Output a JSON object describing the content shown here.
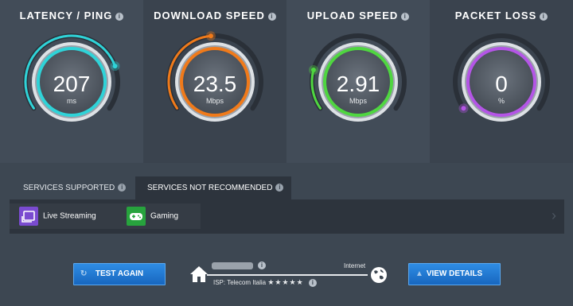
{
  "gauges": [
    {
      "title": "LATENCY / PING",
      "value": "207",
      "unit": "ms",
      "color": "#2fd3d8",
      "level": 0.78
    },
    {
      "title": "DOWNLOAD SPEED",
      "value": "23.5",
      "unit": "Mbps",
      "color": "#f07a1a",
      "level": 0.48
    },
    {
      "title": "UPLOAD SPEED",
      "value": "2.91",
      "unit": "Mbps",
      "color": "#4fd640",
      "level": 0.2
    },
    {
      "title": "PACKET LOSS",
      "value": "0",
      "unit": "%",
      "color": "#b455e6",
      "level": 0.0
    }
  ],
  "tabs": [
    {
      "label": "SERVICES SUPPORTED",
      "active": false
    },
    {
      "label": "SERVICES NOT RECOMMENDED",
      "active": true
    }
  ],
  "services": [
    {
      "label": "Live Streaming",
      "icon": "live-streaming-icon"
    },
    {
      "label": "Gaming",
      "icon": "gamepad-icon"
    }
  ],
  "buttons": {
    "test_again": "TEST AGAIN",
    "view_details": "VIEW DETAILS"
  },
  "connection": {
    "internet_label": "Internet",
    "isp_text": "ISP: Telecom Italia",
    "rating_stars": "★★★★★"
  },
  "info_glyph": "i"
}
